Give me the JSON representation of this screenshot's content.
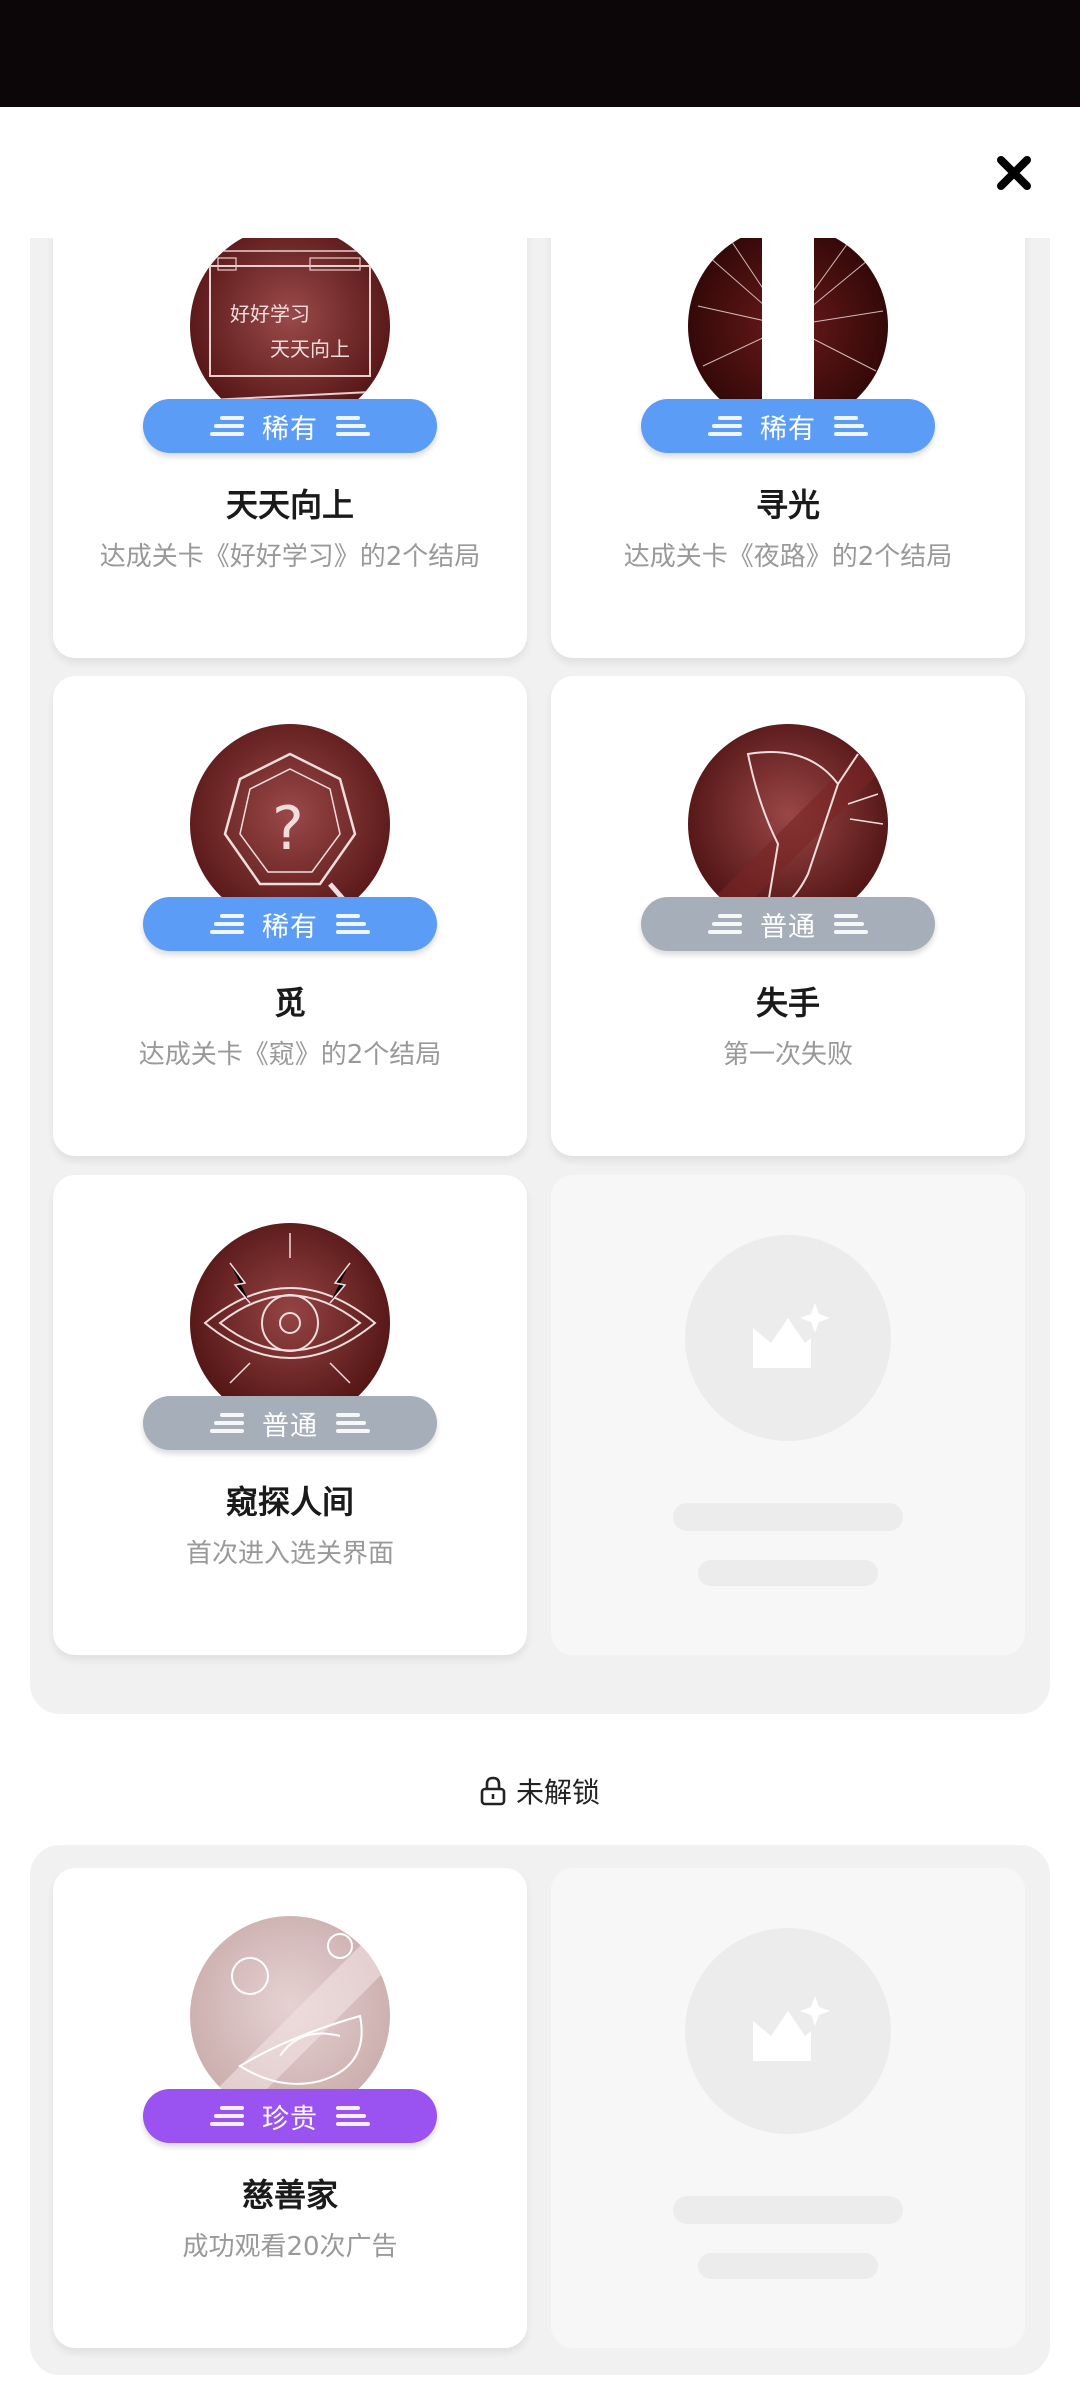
{
  "header": {
    "close_icon": "close-icon"
  },
  "unlocked": [
    {
      "title": "天天向上",
      "desc": "达成关卡《好好学习》的2个结局",
      "rarity": "稀有",
      "rarity_type": "rare",
      "art": "chalkboard",
      "art_text_1": "好好学习",
      "art_text_2": "天天向上"
    },
    {
      "title": "寻光",
      "desc": "达成关卡《夜路》的2个结局",
      "rarity": "稀有",
      "rarity_type": "rare",
      "art": "light-beam"
    },
    {
      "title": "觅",
      "desc": "达成关卡《窥》的2个结局",
      "rarity": "稀有",
      "rarity_type": "rare",
      "art": "magnifier"
    },
    {
      "title": "失手",
      "desc": "第一次失败",
      "rarity": "普通",
      "rarity_type": "common",
      "art": "falling-hand"
    },
    {
      "title": "窥探人间",
      "desc": "首次进入选关界面",
      "rarity": "普通",
      "rarity_type": "common",
      "art": "eye"
    }
  ],
  "locked_section": {
    "label": "未解锁",
    "icon": "lock-icon"
  },
  "locked": [
    {
      "title": "慈善家",
      "desc": "成功观看20次广告",
      "rarity": "珍贵",
      "rarity_type": "precious",
      "art": "coins-hand"
    }
  ],
  "colors": {
    "rare": "#5b9cf6",
    "common": "#a5aeb9",
    "precious": "#9a52f0",
    "badge_dark": "#6b1a1a"
  }
}
